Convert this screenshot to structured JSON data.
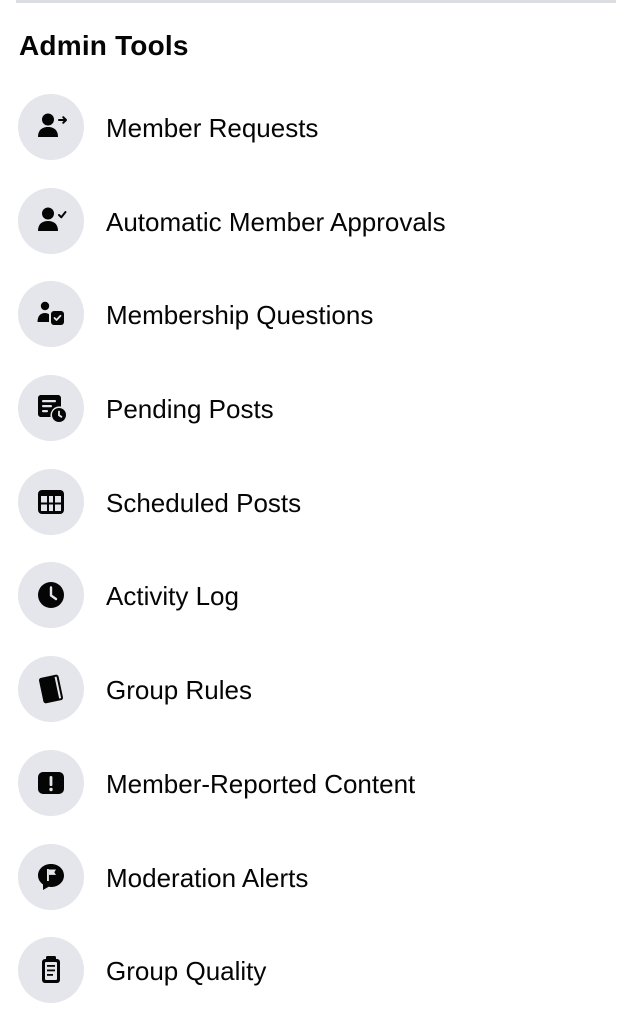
{
  "admin_tools": {
    "title": "Admin Tools",
    "items": [
      {
        "label": "Member Requests",
        "icon": "member-requests-icon"
      },
      {
        "label": "Automatic Member Approvals",
        "icon": "member-approval-icon"
      },
      {
        "label": "Membership Questions",
        "icon": "membership-questions-icon"
      },
      {
        "label": "Pending Posts",
        "icon": "pending-posts-icon"
      },
      {
        "label": "Scheduled Posts",
        "icon": "calendar-icon"
      },
      {
        "label": "Activity Log",
        "icon": "clock-icon"
      },
      {
        "label": "Group Rules",
        "icon": "book-icon"
      },
      {
        "label": "Member-Reported Content",
        "icon": "alert-icon"
      },
      {
        "label": "Moderation Alerts",
        "icon": "flag-speech-icon"
      },
      {
        "label": "Group Quality",
        "icon": "clipboard-icon"
      }
    ]
  },
  "colors": {
    "icon_background": "#e4e6eb",
    "icon_fill": "#050505",
    "text": "#050505",
    "divider": "#dcdee2"
  }
}
